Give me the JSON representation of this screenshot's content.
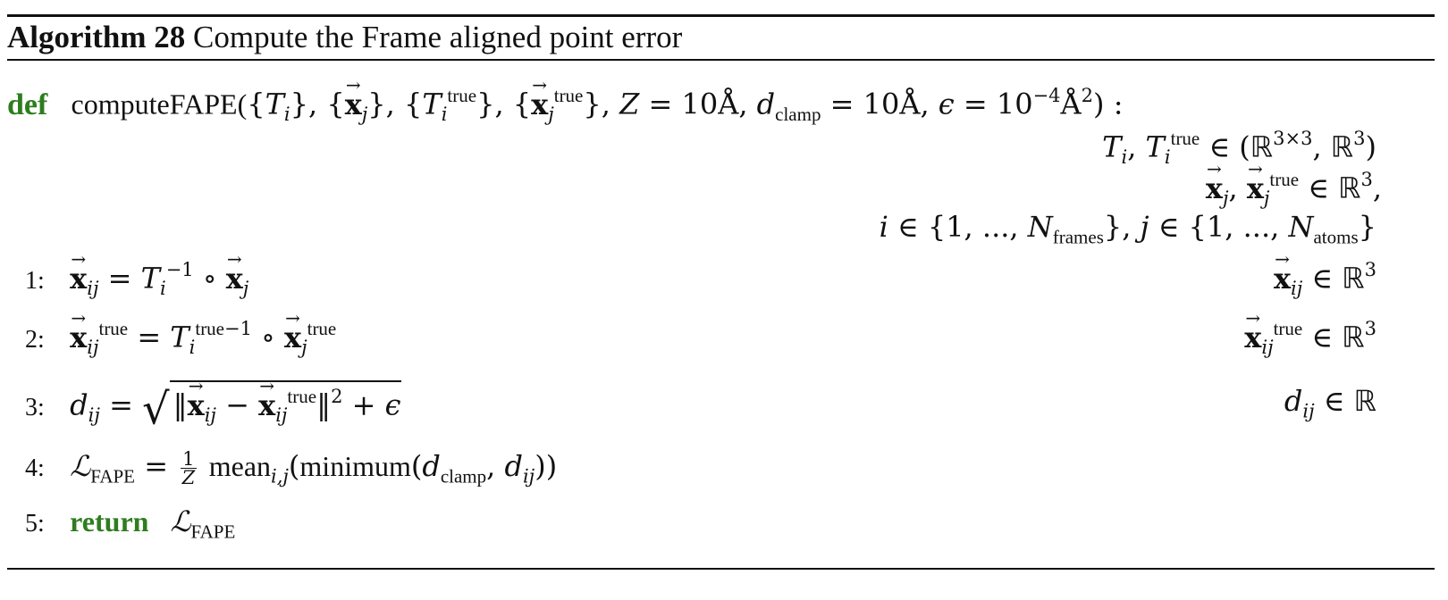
{
  "algorithm": {
    "label": "Algorithm 28",
    "title": "Compute the Frame aligned point error"
  },
  "signature": {
    "keyword": "def",
    "function_name": "computeFAPE",
    "return_keyword": "return"
  },
  "step_numbers": [
    "1:",
    "2:",
    "3:",
    "4:",
    "5:"
  ],
  "accent_colors": {
    "keyword": "#2e7d1f"
  }
}
